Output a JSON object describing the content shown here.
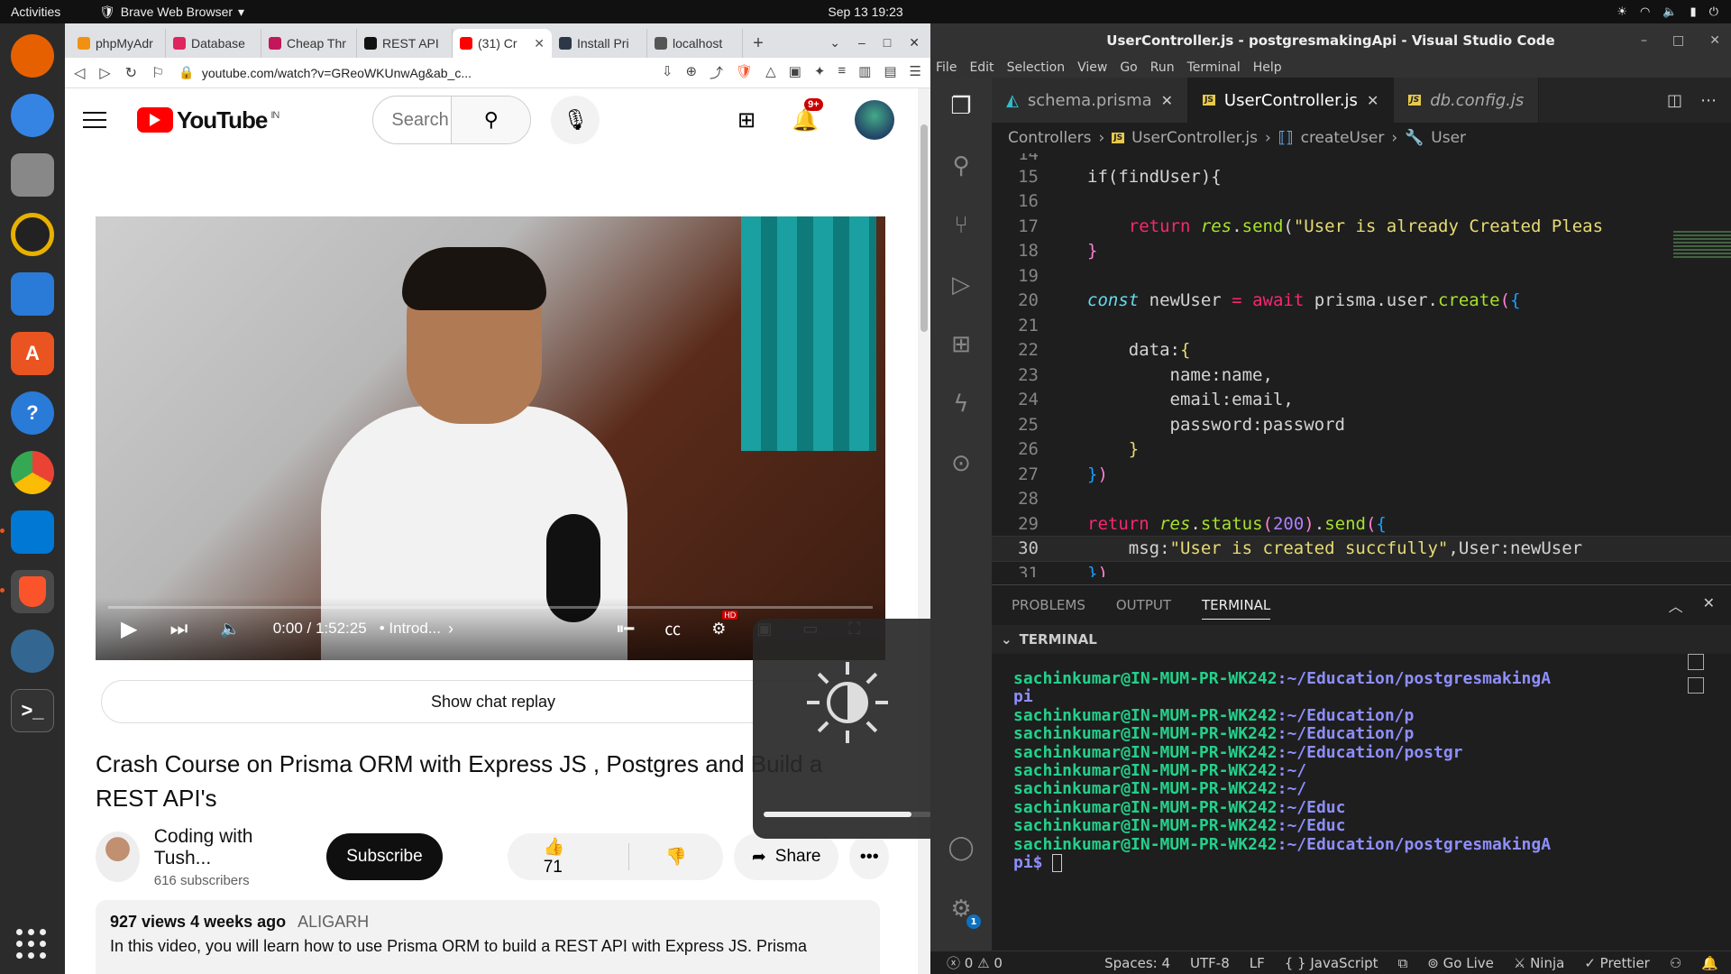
{
  "system": {
    "activities": "Activities",
    "app_name": "Brave Web Browser",
    "clock": "Sep 13  19:23"
  },
  "browser": {
    "tabs": [
      {
        "label": "phpMyAdr",
        "color": "#f29111"
      },
      {
        "label": "Database",
        "color": "#e0245e"
      },
      {
        "label": "Cheap Thr",
        "color": "#c2185b"
      },
      {
        "label": "REST API",
        "color": "#111111"
      },
      {
        "label": "(31) Cr",
        "color": "#ff0000"
      },
      {
        "label": "Install Pri",
        "color": "#2d3748"
      },
      {
        "label": "localhost",
        "color": "#555555"
      }
    ],
    "url": "youtube.com/watch?v=GReoWKUnwAg&ab_c..."
  },
  "youtube": {
    "region": "IN",
    "logo_text": "YouTube",
    "search_placeholder": "Search",
    "notif_count": "9+",
    "player": {
      "time": "0:00 / 1:52:25",
      "chapter": "• Introd...",
      "progress": 0
    },
    "chat_replay": "Show chat replay",
    "title": "Crash Course on Prisma ORM with Express JS , Postgres and Build a REST API's",
    "channel_name": "Coding with Tush...",
    "subscribers": "616 subscribers",
    "subscribe_label": "Subscribe",
    "likes": "71",
    "share_label": "Share",
    "views": "927 views  4 weeks ago",
    "location": "ALIGARH",
    "description": "In this video, you will learn how to use Prisma ORM to build a REST API with Express JS. Prisma"
  },
  "osd": {
    "brightness": 0.88
  },
  "vscode": {
    "title": "UserController.js - postgresmakingApi - Visual Studio Code",
    "menu": [
      "File",
      "Edit",
      "Selection",
      "View",
      "Go",
      "Run",
      "Terminal",
      "Help"
    ],
    "tabs": [
      {
        "label": "schema.prisma"
      },
      {
        "label": "UserController.js"
      },
      {
        "label": "db.config.js"
      }
    ],
    "breadcrumb": [
      "Controllers",
      "UserController.js",
      "createUser",
      "User"
    ],
    "panel_tabs": [
      "PROBLEMS",
      "OUTPUT",
      "TERMINAL"
    ],
    "terminal_header": "TERMINAL",
    "terminal_user": "sachinkumar@IN-MUM-PR-WK242",
    "terminal_lines": [
      ":~/Education/postgresmakingA",
      "pi",
      ":~/Education/p",
      ":~/Education/p",
      ":~/Education/postgr",
      ":~/",
      ":~/",
      ":~/Educ",
      ":~/Educ",
      ":~/Education/postgresmakingA"
    ],
    "terminal_last": "pi$ ",
    "status": {
      "errors": "0",
      "warnings": "0",
      "spaces": "Spaces: 4",
      "encoding": "UTF-8",
      "eol": "LF",
      "language": "JavaScript",
      "golive": "Go Live",
      "ninja": "Ninja",
      "prettier": "Prettier"
    },
    "settings_badge": "1"
  }
}
